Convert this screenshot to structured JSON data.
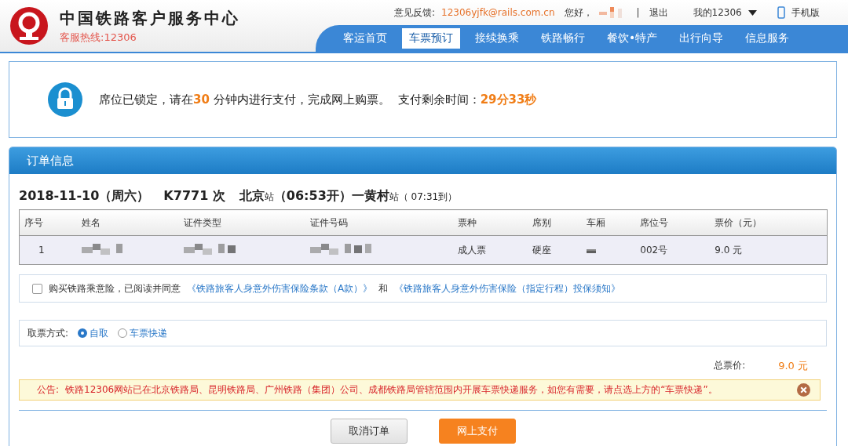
{
  "header": {
    "title": "中国铁路客户服务中心",
    "hotline": "客服热线:12306",
    "feedback_label": "意见反馈:",
    "feedback_email": "12306yjfk@rails.com.cn",
    "greeting": "您好，",
    "separator": "|",
    "logout": "退出",
    "my_account": "我的12306",
    "mobile": "手机版"
  },
  "nav": [
    {
      "label": "客运首页",
      "selected": false
    },
    {
      "label": "车票预订",
      "selected": true
    },
    {
      "label": "接续换乘",
      "selected": false
    },
    {
      "label": "铁路畅行",
      "selected": false
    },
    {
      "label": "餐饮•特产",
      "selected": false
    },
    {
      "label": "出行向导",
      "selected": false
    },
    {
      "label": "信息服务",
      "selected": false
    }
  ],
  "lock_notice": {
    "message": "席位已锁定，请在**30** 分钟内进行支付，完成网上购票。",
    "remaining_label": "支付剩余时间：",
    "remaining": "29分33秒"
  },
  "order": {
    "title": "订单信息",
    "trip": [
      {
        "text": "2018-11-10（周六）",
        "kind": "big"
      },
      {
        "text": "K7771 次",
        "kind": "big"
      },
      {
        "text": "北京",
        "kind": "big"
      },
      {
        "text": "站",
        "kind": "small"
      },
      {
        "text": "（06:53开）一黄村",
        "kind": "big"
      },
      {
        "text": "站",
        "kind": "small"
      },
      {
        "text": "（ 07:31到）",
        "kind": "small"
      }
    ],
    "columns": [
      "序号",
      "姓名",
      "证件类型",
      "证件号码",
      "票种",
      "席别",
      "车厢",
      "席位号",
      "票价（元）"
    ],
    "rows": [
      [
        {
          "kind": "text",
          "text": "1"
        },
        {
          "kind": "redacted"
        },
        {
          "kind": "redacted"
        },
        {
          "kind": "redacted"
        },
        {
          "kind": "text",
          "text": "成人票"
        },
        {
          "kind": "text",
          "text": "硬座"
        },
        {
          "kind": "redacted"
        },
        {
          "kind": "text",
          "text": "002号"
        },
        {
          "kind": "text",
          "text": "9.0 元"
        }
      ]
    ],
    "insurance": {
      "checked": false,
      "text": "购买铁路乘意险，已阅读并同意",
      "link1": "《铁路旅客人身意外伤害保险条款（A款）》",
      "and": "和",
      "link2": "《铁路旅客人身意外伤害保险（指定行程）投保须知》"
    },
    "pickup": {
      "label": "取票方式:",
      "options": [
        {
          "label": "自取",
          "selected": true
        },
        {
          "label": "车票快递",
          "selected": false
        }
      ]
    },
    "total_label": "总票价:",
    "total": "9.0 元",
    "announcement": {
      "label": "公告:",
      "text": "铁路12306网站已在北京铁路局、昆明铁路局、广州铁路（集团）公司、成都铁路局管辖范围内开展车票快递服务，如您有需要，请点选上方的“车票快递”。"
    },
    "buttons": [
      {
        "label": "取消订单",
        "kind": "secondary"
      },
      {
        "label": "网上支付",
        "kind": "primary"
      }
    ]
  }
}
